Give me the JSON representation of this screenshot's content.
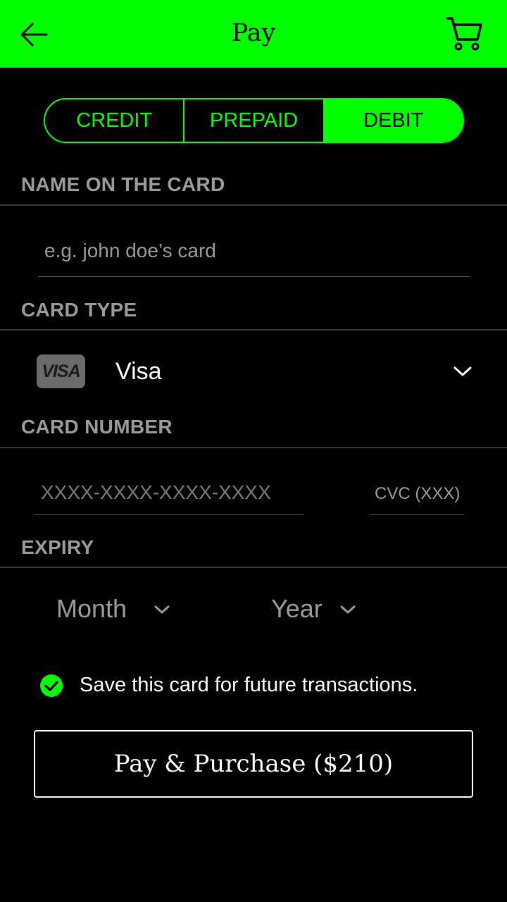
{
  "header": {
    "title": "Pay",
    "back_icon": "arrow-left-icon",
    "cart_icon": "shopping-cart-icon",
    "background_color": "#00ff00"
  },
  "card_kind_tabs": [
    {
      "label": "CREDIT",
      "selected": false
    },
    {
      "label": "PREPAID",
      "selected": false
    },
    {
      "label": "DEBIT",
      "selected": true
    }
  ],
  "name_section": {
    "label": "NAME ON THE CARD",
    "placeholder": "e.g. john doe’s card"
  },
  "card_type_section": {
    "label": "CARD TYPE",
    "badge": "VISA",
    "selected_value": "Visa"
  },
  "card_number_section": {
    "label": "CARD NUMBER",
    "number_placeholder": "XXXX-XXXX-XXXX-XXXX",
    "cvc_placeholder": "CVC (XXX)"
  },
  "expiry_section": {
    "label": "EXPIRY",
    "month_placeholder": "Month",
    "year_placeholder": "Year"
  },
  "save_card": {
    "checked": true,
    "label": "Save this card for future transactions."
  },
  "pay_button": {
    "label": "Pay & Purchase ($210)"
  },
  "colors": {
    "accent": "#00ff00",
    "background": "#000000",
    "muted_text": "#9b9b9b"
  }
}
